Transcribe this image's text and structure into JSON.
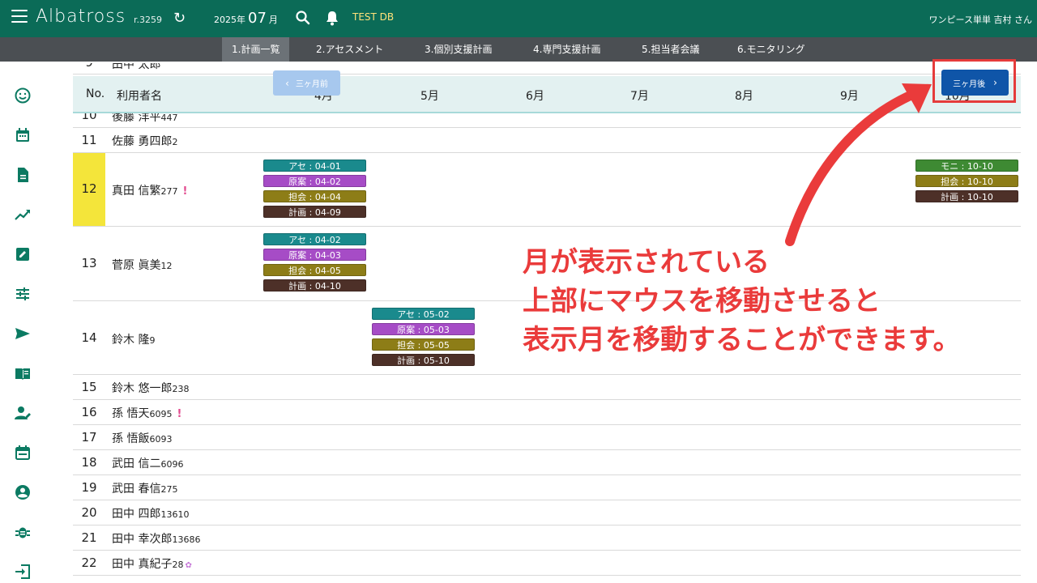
{
  "header": {
    "brand": "Albatross",
    "revision": "r.3259",
    "year": "2025年",
    "month": "07",
    "month_suffix": "月",
    "db_name": "TEST DB",
    "user": "ワンピース単単 吉村 さん"
  },
  "tabs": [
    {
      "label": "1.計画一覧",
      "active": true
    },
    {
      "label": "2.アセスメント"
    },
    {
      "label": "3.個別支援計画"
    },
    {
      "label": "4.専門支援計画"
    },
    {
      "label": "5.担当者会議"
    },
    {
      "label": "6.モニタリング"
    }
  ],
  "sidebar_icons": [
    "smile-icon",
    "calendar-icon",
    "document-icon",
    "trend-icon",
    "edit-icon",
    "sliders-icon",
    "send-icon",
    "book-icon",
    "user-edit-icon",
    "event-icon",
    "account-icon",
    "bug-icon",
    "logout-icon"
  ],
  "table": {
    "col_no": "No.",
    "col_name": "利用者名",
    "months": [
      "4月",
      "5月",
      "6月",
      "7月",
      "8月",
      "9月",
      "10月"
    ],
    "prev_label": "三ヶ月前",
    "next_label": "三ヶ月後",
    "rows": [
      {
        "no": "10",
        "name": "後藤 洋平",
        "id": "447"
      },
      {
        "no": "11",
        "name": "佐藤 勇四郎",
        "id": "2"
      },
      {
        "no": "12",
        "name": "真田 信繁",
        "id": "277",
        "flag": "!"
      },
      {
        "no": "13",
        "name": "菅原 眞美",
        "id": "12"
      },
      {
        "no": "14",
        "name": "鈴木 隆",
        "id": "9"
      },
      {
        "no": "15",
        "name": "鈴木 悠一郎",
        "id": "238"
      },
      {
        "no": "16",
        "name": "孫 悟天",
        "id": "6095",
        "flag": "!"
      },
      {
        "no": "17",
        "name": "孫 悟飯",
        "id": "6093"
      },
      {
        "no": "18",
        "name": "武田 信二",
        "id": "6096"
      },
      {
        "no": "19",
        "name": "武田 春信",
        "id": "275"
      },
      {
        "no": "20",
        "name": "田中 四郎",
        "id": "13610"
      },
      {
        "no": "21",
        "name": "田中 幸次郎",
        "id": "13686"
      },
      {
        "no": "22",
        "name": "田中 真紀子",
        "id": "28"
      }
    ],
    "chips": {
      "r12_apr": [
        "アセ : 04-01",
        "原案 : 04-02",
        "担会 : 04-04",
        "計画 : 04-09"
      ],
      "r12_oct": [
        "モニ : 10-10",
        "担会 : 10-10",
        "計画 : 10-10"
      ],
      "r13_apr": [
        "アセ : 04-02",
        "原案 : 04-03",
        "担会 : 04-05",
        "計画 : 04-10"
      ],
      "r14_may": [
        "アセ : 05-02",
        "原案 : 05-03",
        "担会 : 05-05",
        "計画 : 05-10"
      ]
    }
  },
  "annotation": {
    "lines": [
      "月が表示されている",
      "上部にマウスを移動させると",
      "表示月を移動することができます。"
    ],
    "color": "#ea3b3b"
  }
}
